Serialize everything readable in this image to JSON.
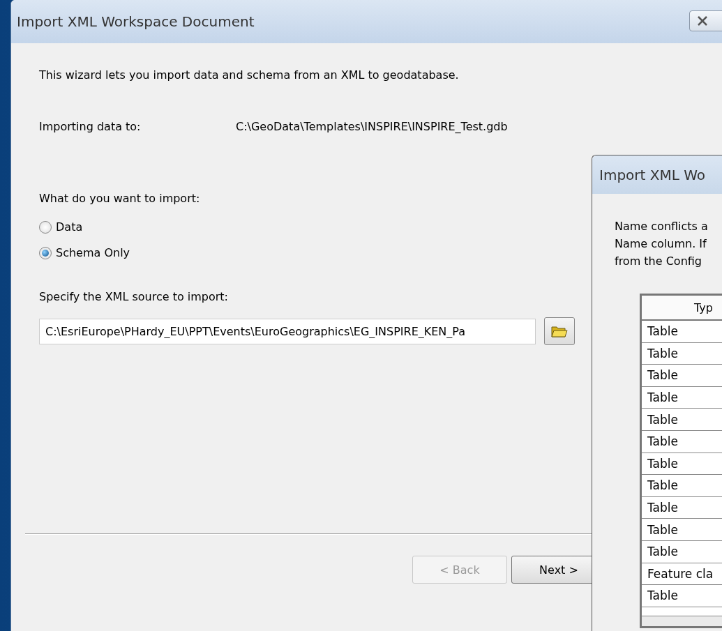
{
  "main_window": {
    "title": "Import XML Workspace Document",
    "intro": "This wizard lets you import data and schema from an XML to geodatabase.",
    "target_label": "Importing data to:",
    "target_path": "C:\\GeoData\\Templates\\INSPIRE\\INSPIRE_Test.gdb",
    "question": "What do you want to import:",
    "options": [
      {
        "label": "Data",
        "selected": false
      },
      {
        "label": "Schema Only",
        "selected": true
      }
    ],
    "source_label": "Specify the XML source to import:",
    "source_field": {
      "value": "C:\\EsriEurope\\PHardy_EU\\PPT\\Events\\EuroGeographics\\EG_INSPIRE_KEN_Pa"
    },
    "buttons": [
      {
        "label": "< Back",
        "disabled": true
      },
      {
        "label": "Next >",
        "disabled": false
      }
    ]
  },
  "second_window": {
    "title": "Import XML Wo",
    "message_lines": [
      "Name conflicts a",
      "Name column. If",
      "from the Config"
    ],
    "table": {
      "columns": [
        "Typ"
      ],
      "rows": [
        "Table",
        "Table",
        "Table",
        "Table",
        "Table",
        "Table",
        "Table",
        "Table",
        "Table",
        "Table",
        "Table",
        "Feature cla",
        "Table"
      ]
    }
  }
}
